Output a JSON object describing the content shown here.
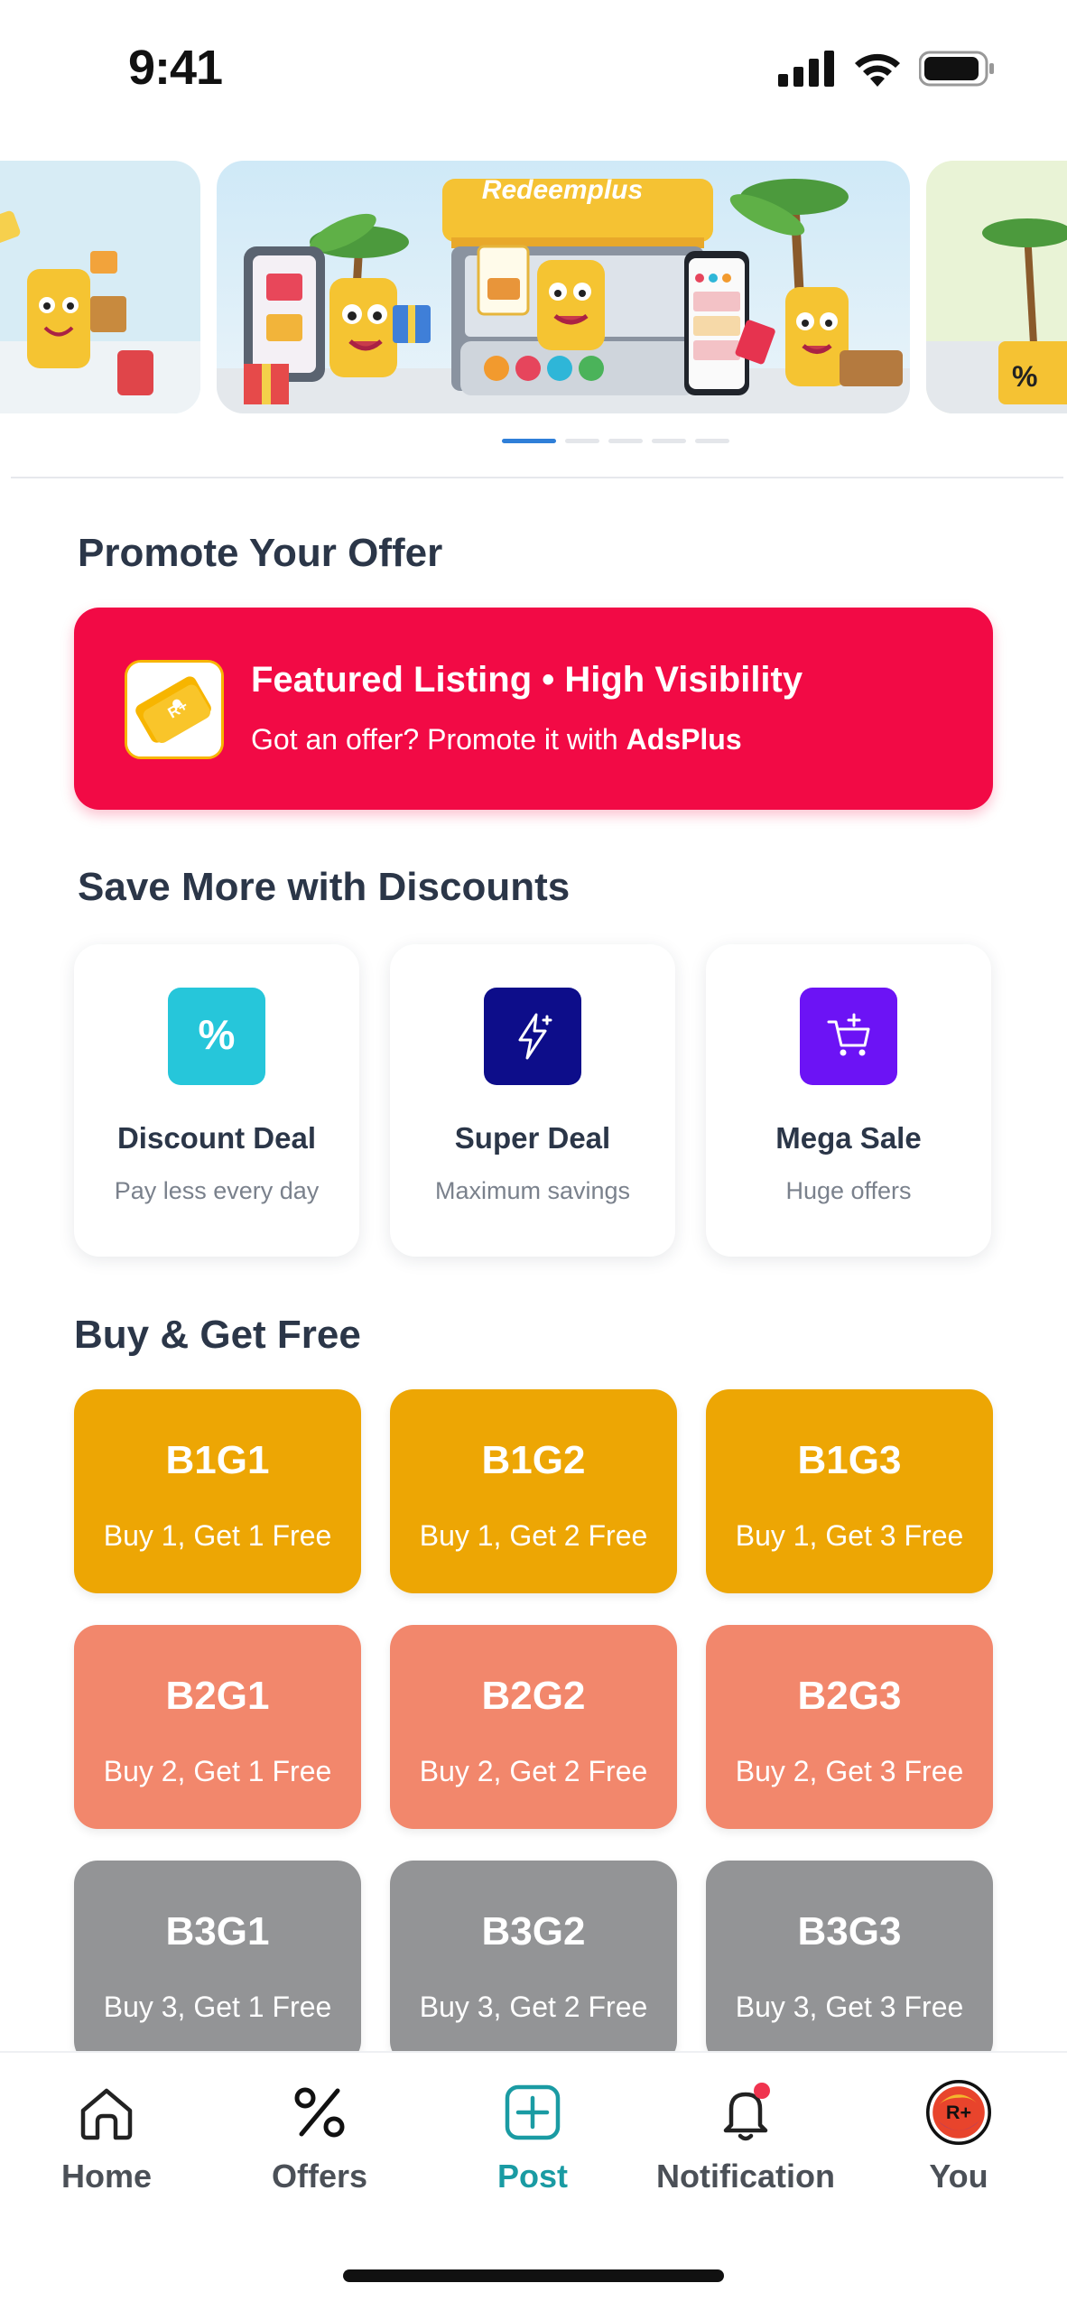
{
  "status_bar": {
    "time": "9:41"
  },
  "carousel": {
    "brand_text": "Redeemplus",
    "slide_count": 5,
    "active_index": 0
  },
  "promote": {
    "title": "Promote Your Offer",
    "headline": "Featured Listing • High Visibility",
    "subtitle_prefix": "Got an offer? Promote it with ",
    "subtitle_brand": "AdsPlus"
  },
  "discounts": {
    "title": "Save More with Discounts",
    "items": [
      {
        "title": "Discount Deal",
        "subtitle": "Pay less every day",
        "icon": "percent-icon",
        "color": "#26c6da"
      },
      {
        "title": "Super Deal",
        "subtitle": "Maximum savings",
        "icon": "lightning-icon",
        "color": "#0d0d8a"
      },
      {
        "title": "Mega Sale",
        "subtitle": "Huge offers",
        "icon": "cart-plus-icon",
        "color": "#6c13f5"
      }
    ]
  },
  "buy_get": {
    "title": "Buy & Get Free",
    "rows": [
      [
        {
          "code": "B1G1",
          "desc": "Buy 1, Get 1 Free"
        },
        {
          "code": "B1G2",
          "desc": "Buy 1, Get 2 Free"
        },
        {
          "code": "B1G3",
          "desc": "Buy 1, Get 3 Free"
        }
      ],
      [
        {
          "code": "B2G1",
          "desc": "Buy 2, Get 1 Free"
        },
        {
          "code": "B2G2",
          "desc": "Buy 2, Get 2 Free"
        },
        {
          "code": "B2G3",
          "desc": "Buy 2, Get 3 Free"
        }
      ],
      [
        {
          "code": "B3G1",
          "desc": "Buy 3, Get 1 Free"
        },
        {
          "code": "B3G2",
          "desc": "Buy 3, Get 2 Free"
        },
        {
          "code": "B3G3",
          "desc": "Buy 3, Get 3 Free"
        }
      ]
    ],
    "colors": [
      "#eda604",
      "#f2876c",
      "#939496"
    ]
  },
  "nav": {
    "items": [
      {
        "label": "Home",
        "icon": "home-icon"
      },
      {
        "label": "Offers",
        "icon": "percent-icon"
      },
      {
        "label": "Post",
        "icon": "plus-square-icon",
        "active": true
      },
      {
        "label": "Notification",
        "icon": "bell-icon",
        "badge": true
      },
      {
        "label": "You",
        "icon": "avatar"
      }
    ],
    "active_color": "#1a9ba3",
    "avatar_text": "R+"
  }
}
